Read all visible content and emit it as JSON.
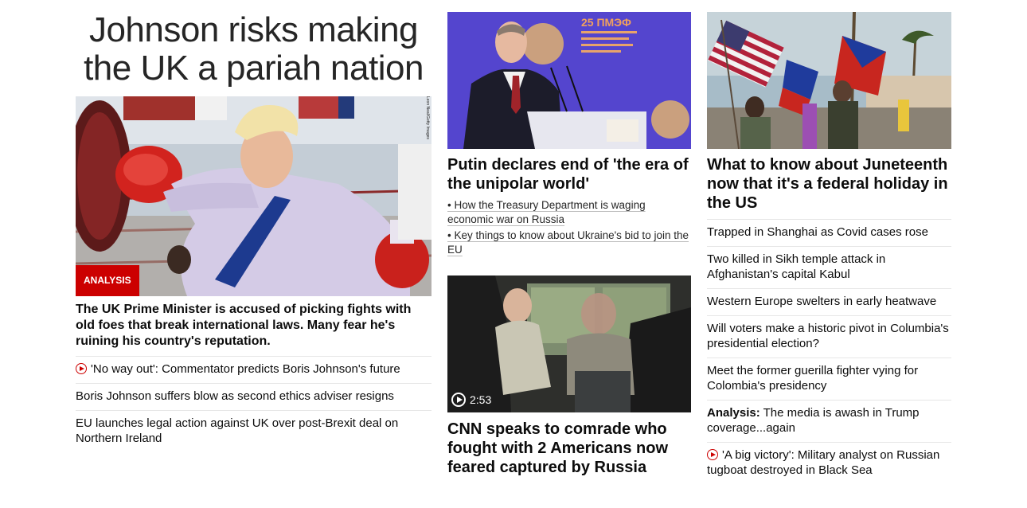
{
  "left": {
    "headline": "Johnson risks making the UK a pariah nation",
    "image_badge": "ANALYSIS",
    "image_credit": "Leon Neal/Getty Images",
    "description": "The UK Prime Minister is accused of picking fights with old foes that break international laws. Many fear he's ruining his country's reputation.",
    "links": [
      {
        "text": "'No way out': Commentator predicts Boris Johnson's future",
        "video": true
      },
      {
        "text": "Boris Johnson suffers blow as second ethics adviser resigns",
        "video": false
      },
      {
        "text": "EU launches legal action against UK over post-Brexit deal on Northern Ireland",
        "video": false
      }
    ]
  },
  "middle": {
    "story1": {
      "headline": "Putin declares end of 'the era of the unipolar world'",
      "bullets": [
        "• How the Treasury Department is waging economic war on Russia",
        "• Key things to know about Ukraine's bid to join the EU"
      ],
      "banner_text": "25 ПМЭФ"
    },
    "story2": {
      "video_duration": "2:53",
      "headline": "CNN speaks to comrade who fought with 2 Americans now feared captured by Russia"
    }
  },
  "right": {
    "headline": "What to know about Juneteenth now that it's a federal holiday in the US",
    "links": [
      {
        "lead": "",
        "text": "Trapped in Shanghai as Covid cases rose",
        "video": false
      },
      {
        "lead": "",
        "text": "Two killed in Sikh temple attack in Afghanistan's capital Kabul",
        "video": false
      },
      {
        "lead": "",
        "text": "Western Europe swelters in early heatwave",
        "video": false
      },
      {
        "lead": "",
        "text": "Will voters make a historic pivot in Columbia's presidential election?",
        "video": false
      },
      {
        "lead": "",
        "text": "Meet the former guerilla fighter vying for Colombia's presidency",
        "video": false
      },
      {
        "lead": "Analysis:",
        "text": " The media is awash in Trump coverage...again",
        "video": false
      },
      {
        "lead": "",
        "text": "'A big victory': Military analyst on Russian tugboat destroyed in Black Sea",
        "video": true
      }
    ]
  },
  "colors": {
    "accent_red": "#cc0000",
    "text": "#0c0c0c",
    "divider": "#e6e6e6"
  }
}
